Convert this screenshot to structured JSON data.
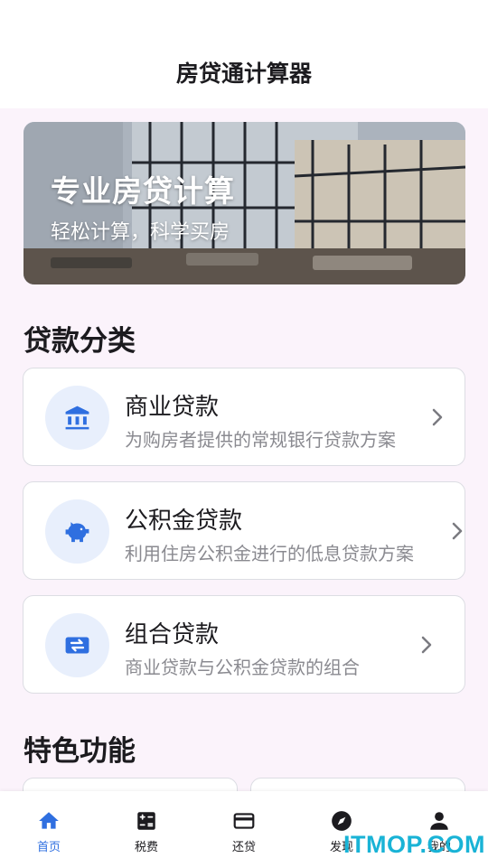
{
  "header": {
    "title": "房贷通计算器"
  },
  "banner": {
    "title": "专业房贷计算",
    "subtitle": "轻松计算，科学买房"
  },
  "sections": {
    "loan_categories": "贷款分类",
    "features": "特色功能"
  },
  "loans": [
    {
      "name": "商业贷款",
      "desc": "为购房者提供的常规银行贷款方案",
      "icon": "bank-icon"
    },
    {
      "name": "公积金贷款",
      "desc": "利用住房公积金进行的低息贷款方案",
      "icon": "piggy-bank-icon"
    },
    {
      "name": "组合贷款",
      "desc": "商业贷款与公积金贷款的组合",
      "icon": "exchange-icon"
    }
  ],
  "nav": [
    {
      "label": "首页",
      "icon": "home-icon",
      "active": true
    },
    {
      "label": "税费",
      "icon": "calculator-icon",
      "active": false
    },
    {
      "label": "还贷",
      "icon": "credit-card-icon",
      "active": false
    },
    {
      "label": "发现",
      "icon": "compass-icon",
      "active": false
    },
    {
      "label": "我的",
      "icon": "person-icon",
      "active": false
    }
  ],
  "watermark": "ITMOP.COM",
  "colors": {
    "accent": "#2f6fe0",
    "icon_bg": "#e8effc",
    "page_bg": "#fbf3fb",
    "desc_text": "#8a8a90"
  }
}
